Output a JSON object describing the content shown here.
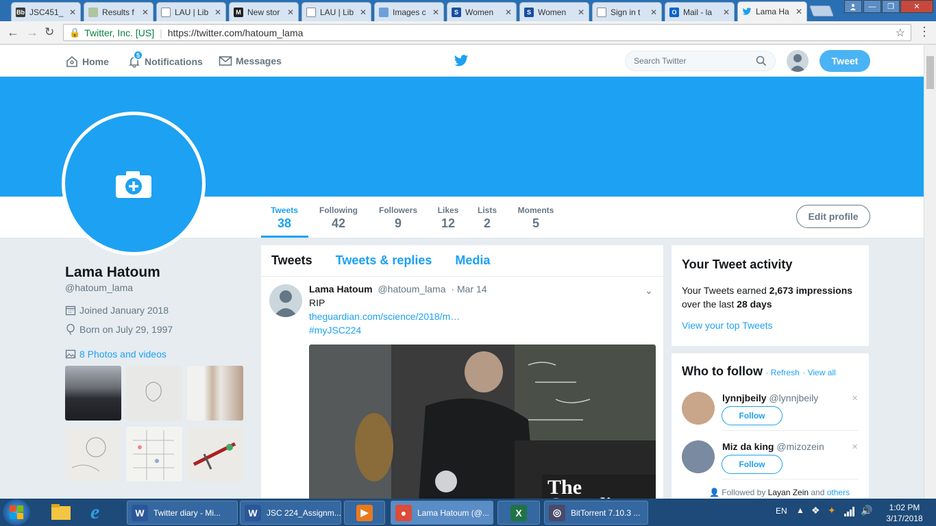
{
  "browser": {
    "tabs": [
      {
        "label": "JSC451_",
        "icon": "blackboard-icon",
        "color": "#3a3a3a",
        "glyph": "Bb"
      },
      {
        "label": "Results f",
        "icon": "page-icon",
        "color": "#b0c4a0",
        "glyph": ""
      },
      {
        "label": "LAU | Lib",
        "icon": "document-icon",
        "color": "#ffffff",
        "glyph": ""
      },
      {
        "label": "New stor",
        "icon": "medium-icon",
        "color": "#222222",
        "glyph": "M"
      },
      {
        "label": "LAU | Lib",
        "icon": "document-icon",
        "color": "#ffffff",
        "glyph": ""
      },
      {
        "label": "Images c",
        "icon": "images-icon",
        "color": "#6ea0d8",
        "glyph": ""
      },
      {
        "label": "Women",
        "icon": "s-logo-icon",
        "color": "#1a4fa0",
        "glyph": "S"
      },
      {
        "label": "Women",
        "icon": "s-logo-icon",
        "color": "#1a4fa0",
        "glyph": "S"
      },
      {
        "label": "Sign in t",
        "icon": "document-icon",
        "color": "#ffffff",
        "glyph": ""
      },
      {
        "label": "Mail - la",
        "icon": "outlook-icon",
        "color": "#0a64c8",
        "glyph": "O"
      },
      {
        "label": "Lama Ha",
        "icon": "twitter-icon",
        "color": "#1da1f2",
        "glyph": ""
      }
    ],
    "secure_label": "Twitter, Inc. [US]",
    "url": "https://twitter.com/hatoum_lama"
  },
  "nav": {
    "home": "Home",
    "notifications": "Notifications",
    "notif_count": "5",
    "messages": "Messages",
    "search_placeholder": "Search Twitter",
    "tweet_button": "Tweet"
  },
  "stats": [
    {
      "label": "Tweets",
      "value": "38"
    },
    {
      "label": "Following",
      "value": "42"
    },
    {
      "label": "Followers",
      "value": "9"
    },
    {
      "label": "Likes",
      "value": "12"
    },
    {
      "label": "Lists",
      "value": "2"
    },
    {
      "label": "Moments",
      "value": "5"
    }
  ],
  "edit_profile": "Edit profile",
  "profile": {
    "name": "Lama Hatoum",
    "handle": "@hatoum_lama",
    "joined": "Joined January 2018",
    "born": "Born on July 29, 1997",
    "photos": "8 Photos and videos"
  },
  "timeline": {
    "tabs": [
      "Tweets",
      "Tweets & replies",
      "Media"
    ],
    "tweet": {
      "name": "Lama Hatoum",
      "handle": "@hatoum_lama",
      "date": "· Mar 14",
      "text": "RIP",
      "link": "theguardian.com/science/2018/m…",
      "hashtag": "#myJSC224",
      "overlay": "The Guardian"
    }
  },
  "activity": {
    "title": "Your Tweet activity",
    "line1_pre": "Your Tweets earned ",
    "impressions": "2,673 impressions",
    "line2_pre": "over the last ",
    "days": "28 days",
    "link": "View your top Tweets"
  },
  "who": {
    "title": "Who to follow",
    "refresh": "· Refresh",
    "viewall": "· View all",
    "users": [
      {
        "name": "lynnjbeily",
        "handle": "@lynnjbeily",
        "follow": "Follow"
      },
      {
        "name": "Miz da king",
        "handle": "@mizozein",
        "follow": "Follow"
      }
    ],
    "followed_pre": "Followed by ",
    "followed_name": "Layan Zein",
    "followed_and": " and ",
    "followed_others": "others"
  },
  "taskbar": {
    "items": [
      {
        "label": "Twitter diary - Mi...",
        "icon": "word-icon",
        "color": "#2b579a",
        "glyph": "W"
      },
      {
        "label": "JSC 224_Assignm...",
        "icon": "word-icon",
        "color": "#2b579a",
        "glyph": "W"
      },
      {
        "label": "",
        "icon": "media-player-icon",
        "color": "#e87a1e",
        "glyph": "▶"
      },
      {
        "label": "Lama Hatoum (@...",
        "icon": "chrome-icon",
        "color": "#dd4b39",
        "glyph": "●"
      },
      {
        "label": "",
        "icon": "excel-icon",
        "color": "#217346",
        "glyph": "X"
      },
      {
        "label": "BitTorrent 7.10.3 ...",
        "icon": "bittorrent-icon",
        "color": "#4a4a6a",
        "glyph": "◎"
      }
    ],
    "lang": "EN",
    "time": "1:02 PM",
    "date": "3/17/2018"
  }
}
